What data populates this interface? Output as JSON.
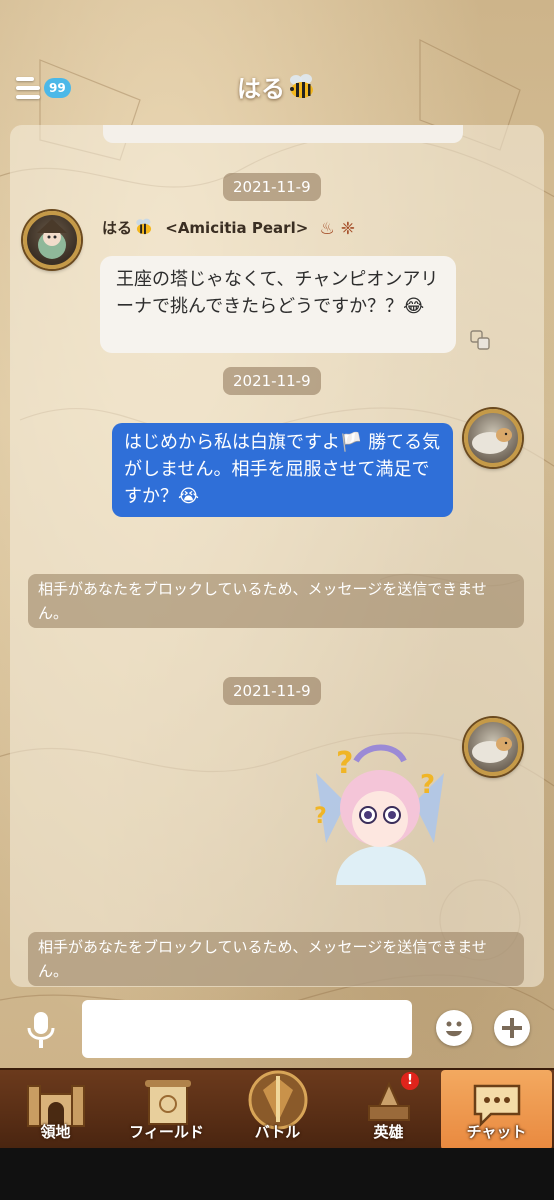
{
  "header": {
    "unread_count": "99",
    "title": "はる"
  },
  "messages": {
    "date_1": "2021-11-9",
    "sender_line": "はる",
    "sender_tag": "<Amicitia Pearl>",
    "incoming_text": "王座の塔じゃなくて、チャンピオンアリーナで挑んできたらどうですか？？😂",
    "date_2": "2021-11-9",
    "outgoing_text": "はじめから私は白旗ですよ🏳️ 勝てる気がしません。相手を屈服させて満足ですか？😭",
    "system_1": "相手があなたをブロックしているため、メッセージを送信できません。",
    "date_3": "2021-11-9",
    "system_2": "相手があなたをブロックしているため、メッセージを送信できません。"
  },
  "input": {
    "placeholder": ""
  },
  "nav": {
    "items": [
      {
        "label": "領地",
        "icon": "castle-icon"
      },
      {
        "label": "フィールド",
        "icon": "map-scroll-icon"
      },
      {
        "label": "バトル",
        "icon": "battle-shield-icon"
      },
      {
        "label": "英雄",
        "icon": "hero-icon",
        "badge": "!"
      },
      {
        "label": "チャット",
        "icon": "chat-bubble-icon",
        "active": true
      }
    ]
  },
  "colors": {
    "outgoing_bubble": "#2f6fd8",
    "badge_blue": "#4bb8e8",
    "nav_active": "#e9893f",
    "nav_bg": "#5a2f16"
  }
}
